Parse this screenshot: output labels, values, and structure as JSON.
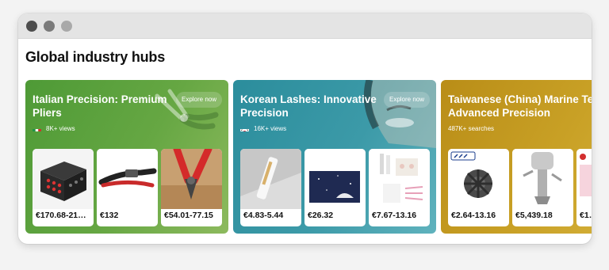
{
  "page": {
    "heading": "Global industry hubs"
  },
  "hubs": [
    {
      "title": "Italian Precision: Premium Pliers",
      "explore_label": "Explore now",
      "meta": "8K+ views",
      "flag": "flag-italy-icon",
      "color": "#5ea03c",
      "products": [
        {
          "price": "€170.68-21…",
          "image": "plier-toolkit-case"
        },
        {
          "price": "€132",
          "image": "wire-stripper-pliers"
        },
        {
          "price": "€54.01-77.15",
          "image": "red-cutting-pliers"
        }
      ]
    },
    {
      "title": "Korean Lashes: Innovative Precision",
      "explore_label": "Explore now",
      "meta": "16K+ views",
      "flag": "flag-korea-icon",
      "color": "#3497a5",
      "products": [
        {
          "price": "€4.83-5.44",
          "image": "lash-serum-tube"
        },
        {
          "price": "€26.32",
          "image": "lash-kit-box"
        },
        {
          "price": "€7.67-13.16",
          "image": "lash-lift-kit"
        }
      ]
    },
    {
      "title": "Taiwanese (China) Marine Tech: Advanced Precision",
      "meta": "487K+ searches",
      "color": "#c39b22",
      "products": [
        {
          "price": "€2.64-13.16",
          "image": "marine-gear-part"
        },
        {
          "price": "€5,439.18",
          "image": "outboard-motor"
        },
        {
          "price": "€1…",
          "image": "marine-product"
        }
      ]
    }
  ]
}
